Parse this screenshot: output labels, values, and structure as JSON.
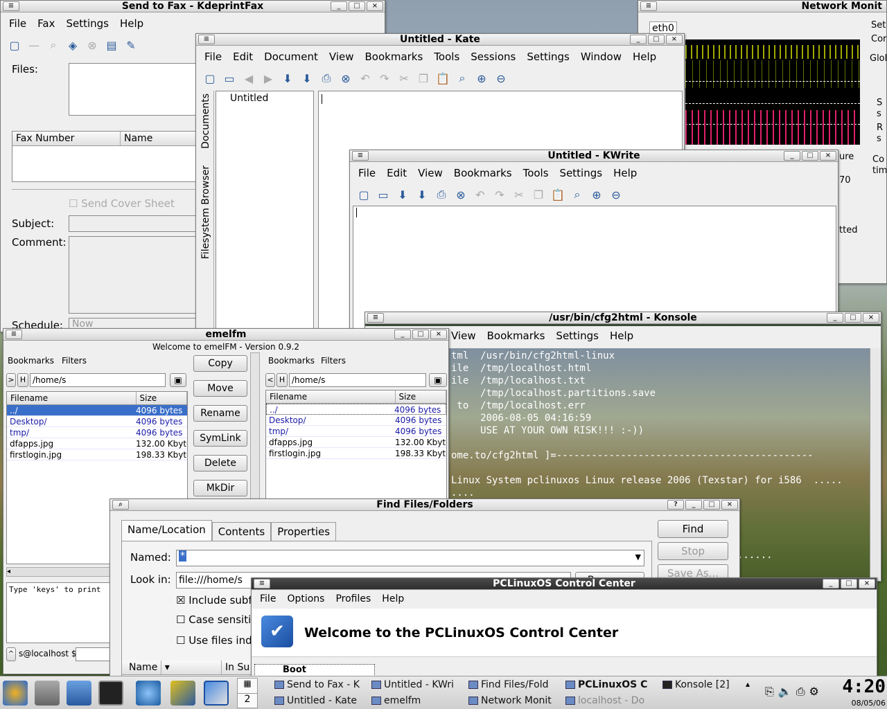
{
  "fax": {
    "title": "Send to Fax - KdeprintFax",
    "menu": [
      "File",
      "Fax",
      "Settings",
      "Help"
    ],
    "files_label": "Files:",
    "col_fax_number": "Fax Number",
    "col_name": "Name",
    "cover_sheet": "Send Cover Sheet",
    "subject_label": "Subject:",
    "comment_label": "Comment:",
    "schedule_label": "Schedule:",
    "schedule_value": "Now"
  },
  "netmon": {
    "title": "Network Monit",
    "tab": "eth0",
    "side": [
      "Sett",
      "Cor",
      "Glol",
      "S",
      "s",
      "R",
      "s",
      "Co",
      "tim"
    ],
    "frag1": "ure",
    "frag2": "70",
    "frag3": "tted"
  },
  "kate": {
    "title": "Untitled - Kate",
    "menu": [
      "File",
      "Edit",
      "Document",
      "View",
      "Bookmarks",
      "Tools",
      "Sessions",
      "Settings",
      "Window",
      "Help"
    ],
    "doc_item": "Untitled",
    "side_tab_documents": "Documents",
    "side_tab_fs": "Filesystem Browser"
  },
  "kwrite": {
    "title": "Untitled - KWrite",
    "menu": [
      "File",
      "Edit",
      "View",
      "Bookmarks",
      "Tools",
      "Settings",
      "Help"
    ]
  },
  "konsole": {
    "title": "/usr/bin/cfg2html - Konsole",
    "menu": [
      "View",
      "Bookmarks",
      "Settings",
      "Help"
    ],
    "lines": [
      "tml  /usr/bin/cfg2html-linux",
      "ile  /tmp/localhost.html",
      "ile  /tmp/localhost.txt",
      "     /tmp/localhost.partitions.save",
      " to  /tmp/localhost.err",
      "     2006-08-05 04:16:59",
      "     USE AT YOUR OWN RISK!!! :-))",
      "",
      "ome.to/cfg2html ]=--------------------------------------------",
      "",
      "Linux System pclinuxos Linux release 2006 (Texstar) for i586  .....",
      "....",
      "",
      "",
      "",
      "",
      "                                                 ......"
    ]
  },
  "emelfm": {
    "title": "emelfm",
    "welcome": "Welcome to emelFM - Version 0.9.2",
    "left": {
      "bookmarks": "Bookmarks",
      "filters": "Filters",
      "path": "/home/s",
      "col_filename": "Filename",
      "col_size": "Size",
      "rows": [
        {
          "name": "../",
          "size": "4096 bytes"
        },
        {
          "name": "Desktop/",
          "size": "4096 bytes"
        },
        {
          "name": "tmp/",
          "size": "4096 bytes"
        },
        {
          "name": "dfapps.jpg",
          "size": "132.00 Kbytes"
        },
        {
          "name": "firstlogin.jpg",
          "size": "198.33 Kbytes"
        }
      ]
    },
    "right": {
      "bookmarks": "Bookmarks",
      "filters": "Filters",
      "path": "/home/s",
      "col_filename": "Filename",
      "col_size": "Size",
      "rows": [
        {
          "name": "../",
          "size": "4096 bytes"
        },
        {
          "name": "Desktop/",
          "size": "4096 bytes"
        },
        {
          "name": "tmp/",
          "size": "4096 bytes"
        },
        {
          "name": "dfapps.jpg",
          "size": "132.00 Kbytes"
        },
        {
          "name": "firstlogin.jpg",
          "size": "198.33 Kbytes"
        }
      ]
    },
    "buttons": [
      "Copy",
      "Move",
      "Rename",
      "SymLink",
      "Delete",
      "MkDir"
    ],
    "console_text": "Type 'keys' to print",
    "prompt": "s@localhost $"
  },
  "find": {
    "title": "Find Files/Folders",
    "tabs": [
      "Name/Location",
      "Contents",
      "Properties"
    ],
    "named_label": "Named:",
    "named_value": "*",
    "lookin_label": "Look in:",
    "lookin_value": "file:///home/s",
    "browse": "Browse...",
    "include_sub": "Include subf",
    "case_sens": "Case sensiti",
    "use_files": "Use files ind",
    "col_name": "Name",
    "col_in": "In Su",
    "btn_find": "Find",
    "btn_stop": "Stop",
    "btn_saveas": "Save As..."
  },
  "pcc": {
    "title": "PCLinuxOS Control Center",
    "menu": [
      "File",
      "Options",
      "Profiles",
      "Help"
    ],
    "welcome": "Welcome to the PCLinuxOS Control Center",
    "tree_item": "Boot"
  },
  "taskbar": {
    "pager": "2",
    "tasks_top": [
      "Send to Fax - K",
      "Untitled - KWri",
      "Find Files/Fold",
      "PCLinuxOS C",
      "Konsole [2]"
    ],
    "tasks_bottom": [
      "Untitled - Kate",
      "emelfm",
      "Network Monit",
      "localhost - Do"
    ],
    "clock": "4:20",
    "date": "08/05/06"
  },
  "colors": {
    "accent": "#3a6fc9",
    "titlebar": "#d8d8d8",
    "console_bg": "#3c4a36"
  }
}
